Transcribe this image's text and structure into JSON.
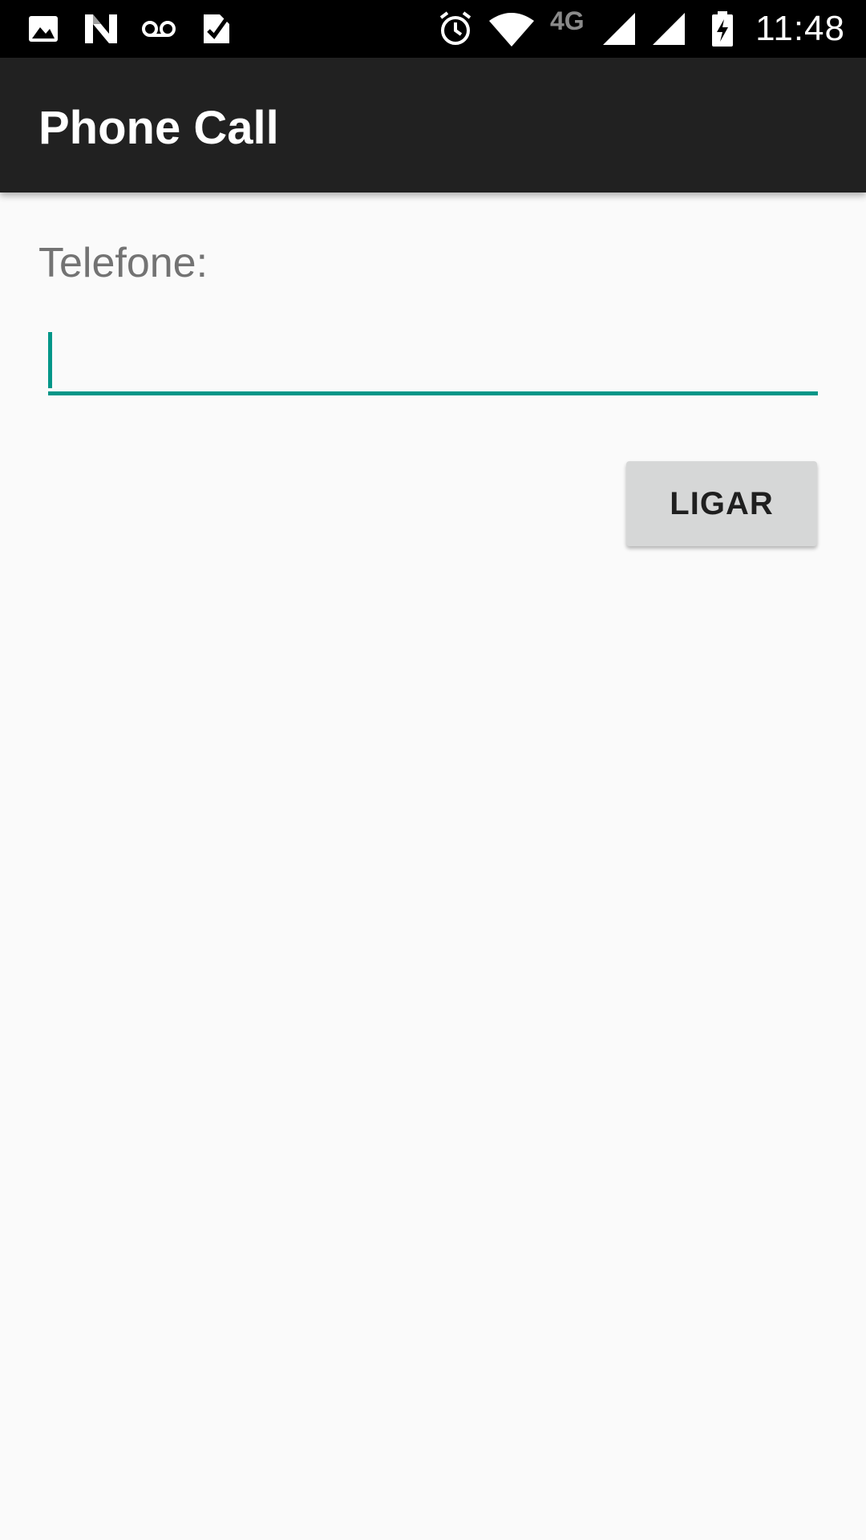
{
  "status_bar": {
    "time": "11:48",
    "network_type": "4G",
    "left_icons": [
      "image-icon",
      "n-logo-icon",
      "voicemail-icon",
      "task-check-icon"
    ],
    "right_icons": [
      "alarm-icon",
      "wifi-icon",
      "cell-signal-icon",
      "cell-signal-icon",
      "battery-charging-icon"
    ]
  },
  "app_bar": {
    "title": "Phone Call",
    "background": "#212121"
  },
  "form": {
    "phone_label": "Telefone:",
    "phone_value": "",
    "call_button_label": "LIGAR"
  },
  "colors": {
    "accent": "#009688",
    "button_bg": "#d6d7d7",
    "page_bg": "#fafafa"
  }
}
